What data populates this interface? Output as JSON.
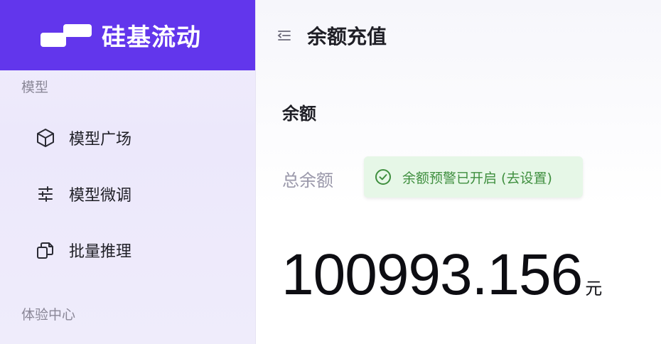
{
  "brand": {
    "name": "硅基流动",
    "color": "#6236ec"
  },
  "sidebar": {
    "sections": [
      {
        "label": "模型"
      },
      {
        "label": "体验中心"
      }
    ],
    "items": [
      {
        "label": "模型广场",
        "icon": "cube-icon"
      },
      {
        "label": "模型微调",
        "icon": "sliders-icon"
      },
      {
        "label": "批量推理",
        "icon": "batch-copy-icon"
      }
    ]
  },
  "header": {
    "title": "余额充值",
    "collapse_icon": "menu-collapse-icon"
  },
  "balance": {
    "heading": "余额",
    "total_label": "总余额",
    "alert_text": "余额预警已开启 (去设置)",
    "alert_color": "#3f8f3f",
    "amount": "100993.156",
    "currency": "元"
  }
}
